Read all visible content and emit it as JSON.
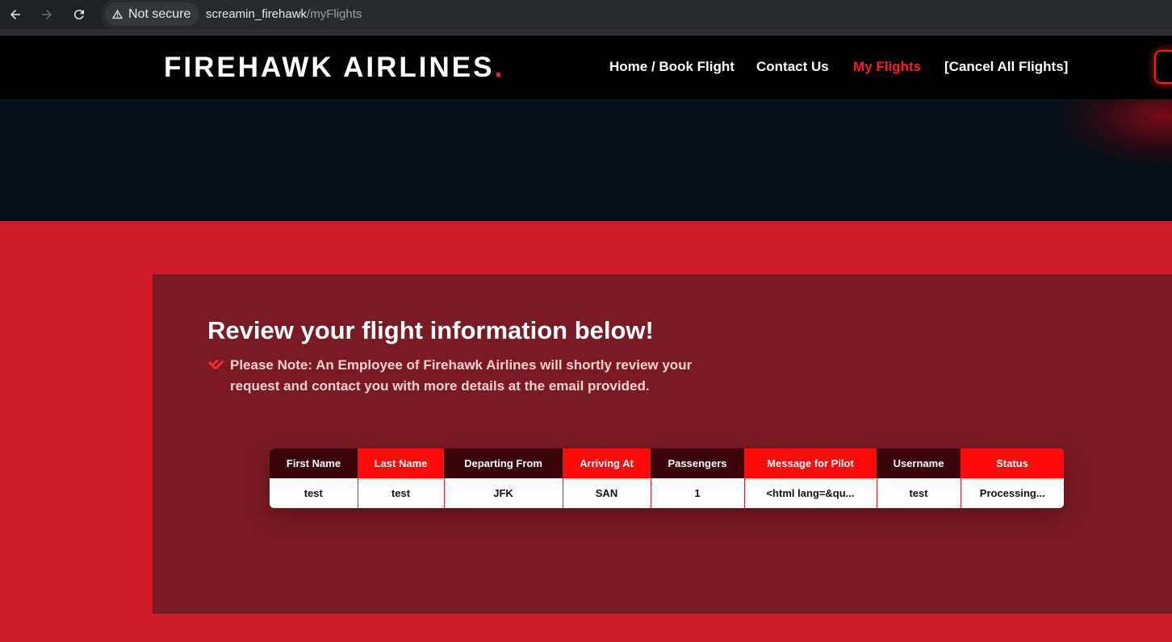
{
  "browser": {
    "security_label": "Not secure",
    "url_host": "screamin_firehawk",
    "url_path": "/myFlights"
  },
  "site": {
    "brand": "FIREHAWK AIRLINES",
    "brand_dot": ".",
    "nav": [
      {
        "label": "Home / Book Flight",
        "active": false
      },
      {
        "label": "Contact Us",
        "active": false
      },
      {
        "label": "My Flights",
        "active": true
      },
      {
        "label": "[Cancel All Flights]",
        "active": false
      }
    ]
  },
  "main": {
    "title": "Review your flight information below!",
    "note": "Please Note: An Employee of Firehawk Airlines will shortly review your request and contact you with more details at the email provided.",
    "table": {
      "columns": [
        "First Name",
        "Last Name",
        "Departing From",
        "Arriving At",
        "Passengers",
        "Message for Pilot",
        "Username",
        "Status"
      ],
      "rows": [
        [
          "test",
          "test",
          "JFK",
          "SAN",
          "1",
          "<html lang=&qu...",
          "test",
          "Processing..."
        ]
      ]
    }
  },
  "colors": {
    "page_red": "#d01c28",
    "card_maroon": "#7a1b24",
    "accent_red": "#ff1a1a",
    "header_dark": "#3a0409"
  }
}
